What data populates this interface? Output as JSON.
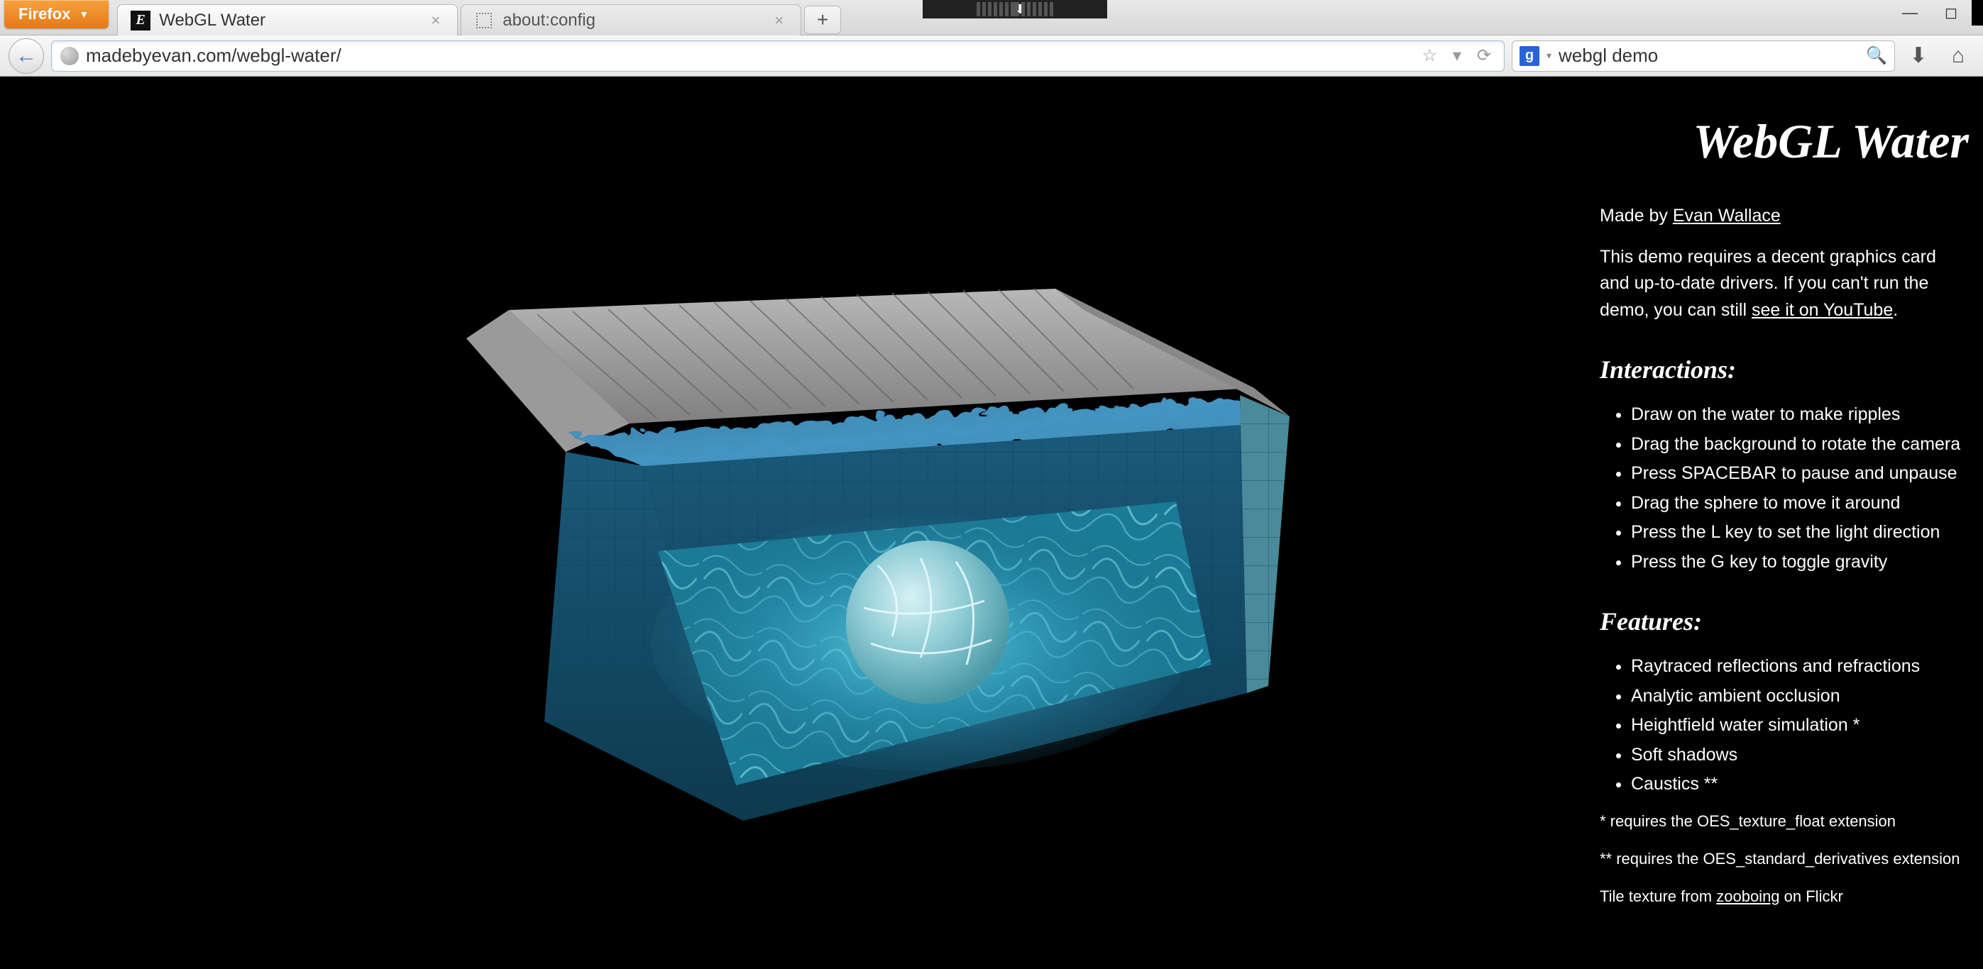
{
  "browser": {
    "app_button": "Firefox",
    "tabs": [
      {
        "title": "WebGL Water",
        "favicon": "E",
        "active": true
      },
      {
        "title": "about:config",
        "favicon": "dotted",
        "active": false
      }
    ],
    "url": "madebyevan.com/webgl-water/",
    "search_engine_glyph": "g",
    "search_value": "webgl demo"
  },
  "page": {
    "title": "WebGL Water",
    "byline_prefix": "Made by ",
    "author": "Evan Wallace",
    "requirements_1": "This demo requires a decent graphics card and up-to-date drivers. If you can't run the demo, you can still ",
    "requirements_link": "see it on YouTube",
    "requirements_2": ".",
    "interactions_heading": "Interactions:",
    "interactions": [
      "Draw on the water to make ripples",
      "Drag the background to rotate the camera",
      "Press SPACEBAR to pause and unpause",
      "Drag the sphere to move it around",
      "Press the L key to set the light direction",
      "Press the G key to toggle gravity"
    ],
    "features_heading": "Features:",
    "features": [
      "Raytraced reflections and refractions",
      "Analytic ambient occlusion",
      "Heightfield water simulation *",
      "Soft shadows",
      "Caustics **"
    ],
    "footnote1": "* requires the OES_texture_float extension",
    "footnote2": "** requires the OES_standard_derivatives extension",
    "credit_prefix": "Tile texture from ",
    "credit_link": "zooboing",
    "credit_suffix": " on Flickr"
  }
}
